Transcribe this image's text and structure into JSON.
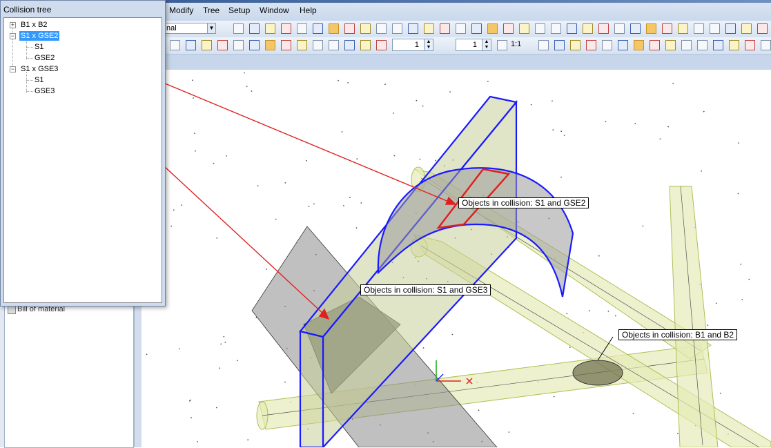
{
  "menu": [
    "Modify",
    "Tree",
    "Setup",
    "Window",
    "Help"
  ],
  "toolbar": {
    "view_combo_value": "nal",
    "spin1_value": "1",
    "spin2_value": "1",
    "scale_label": "1:1"
  },
  "collision_tree": {
    "title": "Collision tree",
    "nodes": [
      {
        "label": "B1 x B2",
        "children": []
      },
      {
        "label": "S1 x GSE2",
        "selected": true,
        "children": [
          "S1",
          "GSE2"
        ]
      },
      {
        "label": "S1 x GSE3",
        "children": [
          "S1",
          "GSE3"
        ]
      }
    ]
  },
  "left_panel": {
    "item_label": "Bill of material"
  },
  "callouts": [
    "Objects in collision: S1 and GSE2",
    "Objects in collision: S1 and GSE3",
    "Objects in collision: B1 and B2"
  ],
  "colors": {
    "highlight": "#3399ff",
    "arrow": "#e02020",
    "outline": "#1a1aff",
    "pipe_fill": "#e6ebb8",
    "pipe_stroke": "#aebf52"
  }
}
